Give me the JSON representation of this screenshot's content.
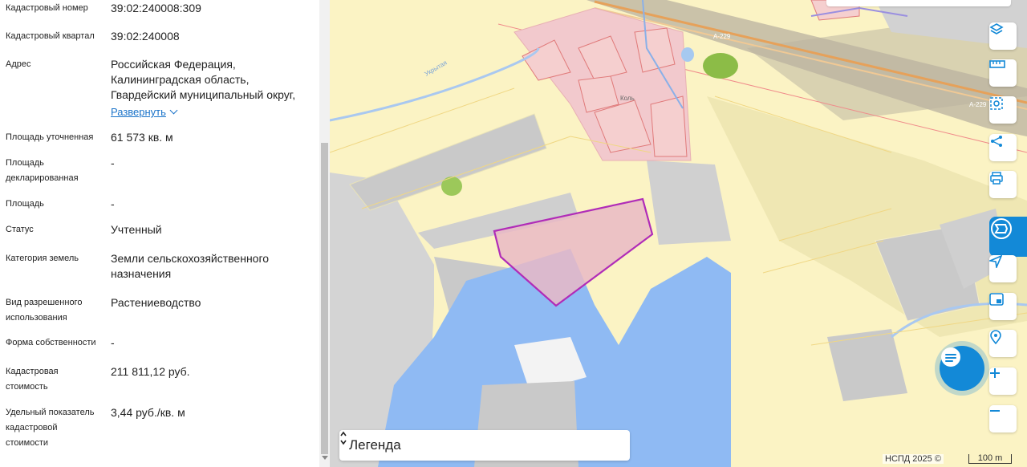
{
  "panel": {
    "rows": [
      {
        "label": "Кадастровый номер",
        "value": "39:02:240008:309"
      },
      {
        "label": "Кадастровый квартал",
        "value": "39:02:240008"
      },
      {
        "label": "Адрес",
        "value_lines": [
          "Российская Федерация,",
          "Калининградская область,",
          "Гвардейский муниципальный округ,"
        ],
        "link": "Развернуть"
      },
      {
        "label": "Площадь уточненная",
        "value": "61 573 кв. м"
      },
      {
        "label_lines": [
          "Площадь",
          "декларированная"
        ],
        "value": "-"
      },
      {
        "label": "Площадь",
        "value": "-"
      },
      {
        "label": "Статус",
        "value": "Учтенный"
      },
      {
        "label": "Категория земель",
        "value_lines": [
          "Земли сельскохозяйственного",
          "назначения"
        ]
      },
      {
        "label_lines": [
          "Вид разрешенного",
          "использования"
        ],
        "value": "Растениеводство"
      },
      {
        "label": "Форма собственности",
        "value": "-"
      },
      {
        "label_lines": [
          "Кадастровая",
          "стоимость"
        ],
        "value": "211 811,12 руб."
      },
      {
        "label_lines": [
          "Удельный показатель",
          "кадастровой",
          "стоимости"
        ],
        "value": "3,44 руб./кв. м"
      }
    ]
  },
  "map": {
    "legend_title": "Легенда",
    "attribution": "НСПД 2025 ©",
    "scale": "100 m",
    "labels": {
      "road": "А-229",
      "village": "Коль",
      "stream": "Укрытая"
    },
    "controls": [
      "layers-icon",
      "ruler-icon",
      "select-area-icon",
      "share-icon",
      "print-icon",
      "service-icon",
      "locate-icon",
      "minimap-icon",
      "geo-pin-icon",
      "zoom-in-icon",
      "zoom-out-icon"
    ]
  },
  "colors": {
    "accent": "#1389d7",
    "link": "#1a73c9",
    "parcel_border": "#b02cb8",
    "parcel_fill": "#f2c2cf",
    "water": "#8fbaf3",
    "field": "#fbf3c4"
  }
}
